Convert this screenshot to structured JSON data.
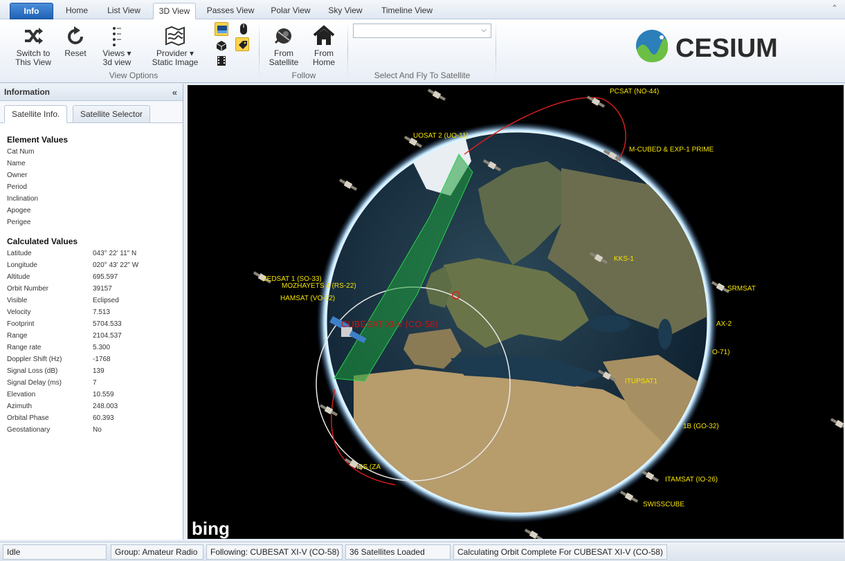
{
  "tabs": [
    {
      "label": "Info"
    },
    {
      "label": "Home"
    },
    {
      "label": "List View"
    },
    {
      "label": "3D View"
    },
    {
      "label": "Passes View"
    },
    {
      "label": "Polar View"
    },
    {
      "label": "Sky View"
    },
    {
      "label": "Timeline View"
    }
  ],
  "ribbon": {
    "switch_label_1": "Switch to",
    "switch_label_2": "This View",
    "reset_label": "Reset",
    "views_label_1": "Views",
    "views_label_2": "3d view",
    "provider_label_1": "Provider",
    "provider_label_2": "Static Image",
    "view_options_group": "View Options",
    "from_satellite_1": "From",
    "from_satellite_2": "Satellite",
    "from_home_1": "From",
    "from_home_2": "Home",
    "follow_group": "Follow",
    "select_group": "Select And Fly To Satellite",
    "select_value": "",
    "logo_text": "CESIUM"
  },
  "panel": {
    "title": "Information",
    "tab_info": "Satellite Info.",
    "tab_selector": "Satellite Selector",
    "element_values_title": "Element Values",
    "element_values": [
      {
        "key": "Cat Num",
        "value": ""
      },
      {
        "key": "Name",
        "value": ""
      },
      {
        "key": "Owner",
        "value": ""
      },
      {
        "key": "Period",
        "value": ""
      },
      {
        "key": "Inclination",
        "value": ""
      },
      {
        "key": "Apogee",
        "value": ""
      },
      {
        "key": "Perigee",
        "value": ""
      }
    ],
    "calculated_values_title": "Calculated Values",
    "calculated_values": [
      {
        "key": "Latitude",
        "value": "043° 22' 11\" N"
      },
      {
        "key": "Longitude",
        "value": "020° 43' 22\" W"
      },
      {
        "key": "Altitude",
        "value": "695.597"
      },
      {
        "key": "Orbit Number",
        "value": "39157"
      },
      {
        "key": "Visible",
        "value": "Eclipsed"
      },
      {
        "key": "Velocity",
        "value": "7.513"
      },
      {
        "key": "Footprint",
        "value": "5704.533"
      },
      {
        "key": "Range",
        "value": "2104.537"
      },
      {
        "key": "Range rate",
        "value": "5.300"
      },
      {
        "key": "Doppler Shift (Hz)",
        "value": "-1768"
      },
      {
        "key": "Signal Loss (dB)",
        "value": "139"
      },
      {
        "key": "Signal Delay (ms)",
        "value": "7"
      },
      {
        "key": "Elevation",
        "value": "10.559"
      },
      {
        "key": "Azimuth",
        "value": "248.003"
      },
      {
        "key": "Orbital Phase",
        "value": "60.393"
      },
      {
        "key": "Geostationary",
        "value": "No"
      }
    ]
  },
  "viewer": {
    "selected_satellite": "CUBESAT XI-V (CO-58)",
    "bing_logo": "bing",
    "satellite_labels": [
      "PCSAT (NO-44)",
      "UOSAT 2 (UO-11)",
      "M-CUBED & EXP-1 PRIME",
      "SEDSAT 1 (SO-33)",
      "MOZHAYETS 4 (RS-22)",
      "HAMSAT (VO-52)",
      "KKS-1",
      "SRMSAT",
      "AX-2",
      "O-71)",
      "ITUPSAT1",
      "1B (GO-32)",
      "ISS (ZA",
      "ITAMSAT (IO-26)",
      "SWISSCUBE"
    ]
  },
  "status": {
    "state": "Idle",
    "group": "Group: Amateur Radio",
    "following": "Following: CUBESAT XI-V (CO-58)",
    "loaded": "36 Satellites Loaded",
    "message": "Calculating Orbit Complete For CUBESAT XI-V (CO-58)"
  }
}
